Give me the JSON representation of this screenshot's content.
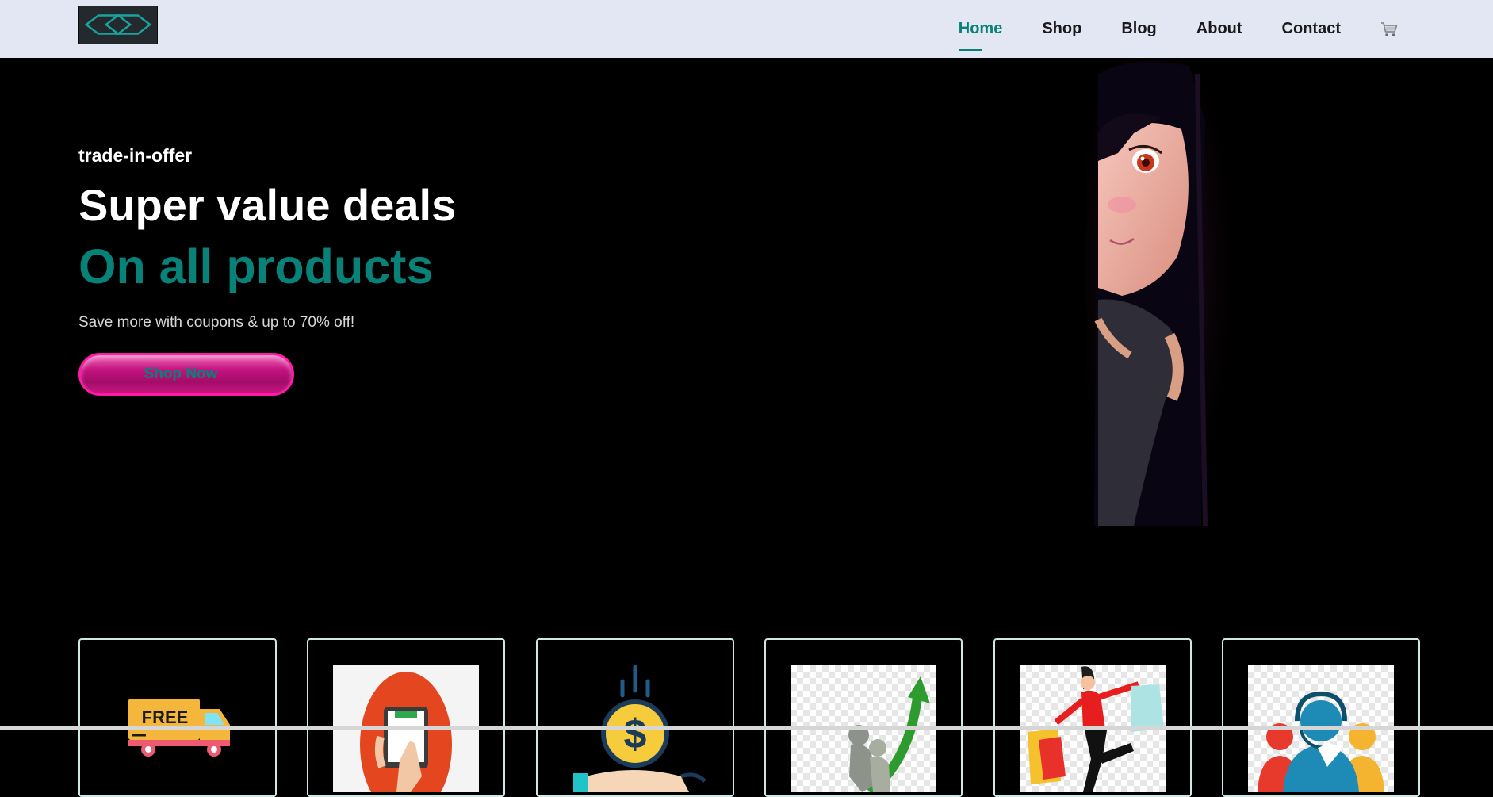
{
  "nav": {
    "logo_icon": "logo-mark",
    "items": [
      {
        "label": "Home",
        "active": true
      },
      {
        "label": "Shop",
        "active": false
      },
      {
        "label": "Blog",
        "active": false
      },
      {
        "label": "About",
        "active": false
      },
      {
        "label": "Contact",
        "active": false
      }
    ],
    "cart_icon": "shopping-cart-icon"
  },
  "hero": {
    "tagline": "trade-in-offer",
    "headline": "Super value deals",
    "subheadline": "On all products",
    "description": "Save more with coupons & up to 70% off!",
    "button_label": "Shop Now",
    "image": "anime-girl-portrait"
  },
  "features": [
    {
      "icon": "free-shipping-truck-icon"
    },
    {
      "icon": "online-order-tablet-icon"
    },
    {
      "icon": "save-money-icon"
    },
    {
      "icon": "growth-arrow-icon"
    },
    {
      "icon": "happy-shopper-icon"
    },
    {
      "icon": "customer-support-icon"
    }
  ],
  "colors": {
    "accent": "#088178",
    "nav_bg": "#e3e6f3",
    "hero_bg": "#000000",
    "button_pink": "#c4127f"
  }
}
